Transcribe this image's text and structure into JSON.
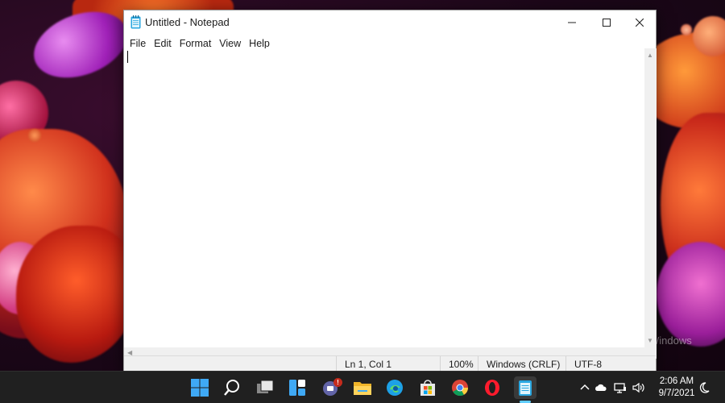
{
  "window": {
    "title": "Untitled - Notepad"
  },
  "menu": {
    "items": [
      "File",
      "Edit",
      "Format",
      "View",
      "Help"
    ]
  },
  "editor": {
    "content": ""
  },
  "status_bar": {
    "position": "Ln 1, Col 1",
    "zoom": "100%",
    "line_ending": "Windows (CRLF)",
    "encoding": "UTF-8"
  },
  "watermark": {
    "text": "Windows"
  },
  "taskbar": {
    "apps": [
      {
        "name": "start-icon"
      },
      {
        "name": "search-icon"
      },
      {
        "name": "task-view-icon"
      },
      {
        "name": "widgets-icon"
      },
      {
        "name": "teams-chat-icon",
        "badge": "!"
      },
      {
        "name": "file-explorer-icon"
      },
      {
        "name": "edge-icon"
      },
      {
        "name": "microsoft-store-icon"
      },
      {
        "name": "chrome-icon"
      },
      {
        "name": "opera-icon"
      },
      {
        "name": "notepad-icon",
        "active": true
      }
    ],
    "tray": {
      "icons": [
        "chevron-up-icon",
        "onedrive-cloud-icon",
        "network-icon",
        "volume-icon",
        "focus-moon-icon"
      ],
      "time": "2:06 AM",
      "date": "9/7/2021"
    }
  },
  "colors": {
    "accent": "#60cdff",
    "taskbar": "#202020",
    "badge": "#c42b1c"
  }
}
